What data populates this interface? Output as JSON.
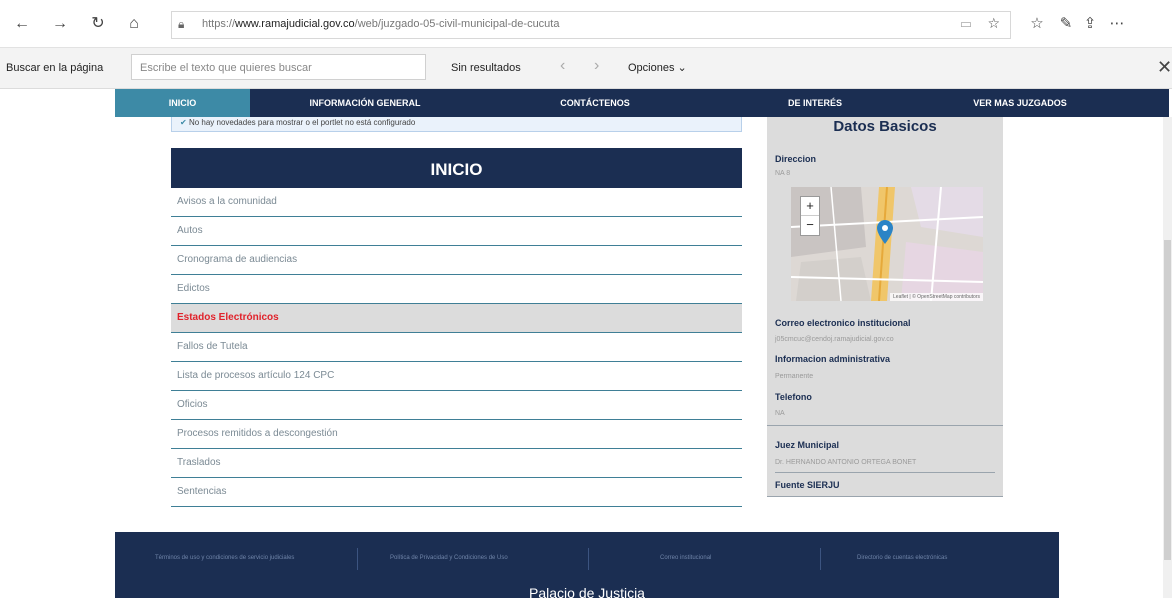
{
  "browser": {
    "url_prefix": "https://",
    "url_domain": "www.ramajudicial.gov.co",
    "url_path": "/web/juzgado-05-civil-municipal-de-cucuta"
  },
  "findbar": {
    "label": "Buscar en la página",
    "placeholder": "Escribe el texto que quieres buscar",
    "status": "Sin resultados",
    "options_label": "Opciones"
  },
  "site_nav": [
    "INICIO",
    "INFORMACIÓN GENERAL",
    "CONTÁCTENOS",
    "DE INTERÉS",
    "VER MAS JUZGADOS"
  ],
  "notice": "No hay novedades para mostrar o el portlet no está configurado",
  "panel": {
    "title": "INICIO",
    "items": [
      "Avisos a la comunidad",
      "Autos",
      "Cronograma de audiencias",
      "Edictos",
      "Estados Electrónicos",
      "Fallos de Tutela",
      "Lista de procesos artículo 124 CPC",
      "Oficios",
      "Procesos remitidos a descongestión",
      "Traslados",
      "Sentencias"
    ],
    "selected_index": 4
  },
  "datos": {
    "title": "Datos Basicos",
    "direccion_label": "Direccion",
    "direccion_value": "NA 8",
    "map_zoom_in": "+",
    "map_zoom_out": "−",
    "map_attribution": "Leaflet | © OpenStreetMap contributors",
    "correo_label": "Correo electronico institucional",
    "correo_value": "j05cmcuc@cendoj.ramajudicial.gov.co",
    "info_admin_label": "Informacion administrativa",
    "info_admin_value": "Permanente",
    "telefono_label": "Telefono",
    "telefono_value": "NA",
    "juez_label": "Juez Municipal",
    "juez_value": "Dr. HERNANDO ANTONIO ORTEGA BONET",
    "fuente_label": "Fuente SIERJU"
  },
  "footer": {
    "links": [
      "Términos de uso y condiciones de servicio judiciales",
      "Política de Privacidad y Condiciones de Uso",
      "Correo institucional",
      "Directorio de cuentas electrónicas"
    ],
    "title": "Palacio de Justicia"
  }
}
